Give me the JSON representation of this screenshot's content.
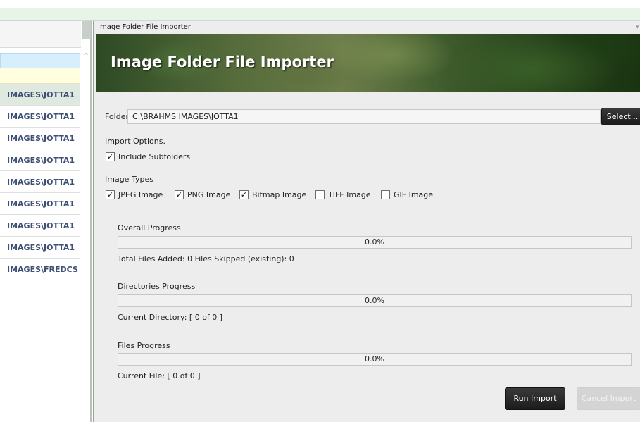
{
  "left_panel": {
    "rows": [
      "IMAGES\\JOTTA1",
      "IMAGES\\JOTTA1",
      "IMAGES\\JOTTA1",
      "IMAGES\\JOTTA1",
      "IMAGES\\JOTTA1",
      "IMAGES\\JOTTA1",
      "IMAGES\\JOTTA1",
      "IMAGES\\JOTTA1",
      "IMAGES\\FREDCS"
    ]
  },
  "importer": {
    "window_title": "Image Folder File Importer",
    "banner_title": "Image Folder File Importer",
    "folder_label": "Folder",
    "folder_value": "C:\\BRAHMS IMAGES\\JOTTA1",
    "select_label": "Select...",
    "import_options_label": "Import Options.",
    "include_subfolders": {
      "label": "Include Subfolders",
      "checked": true
    },
    "image_types_label": "Image Types",
    "image_types": [
      {
        "label": "JPEG Image",
        "checked": true
      },
      {
        "label": "PNG Image",
        "checked": true
      },
      {
        "label": "Bitmap Image",
        "checked": true
      },
      {
        "label": "TIFF Image",
        "checked": false
      },
      {
        "label": "GIF Image",
        "checked": false
      }
    ],
    "overall": {
      "label": "Overall Progress",
      "value": "0.0%",
      "progress": 0.0
    },
    "totals_text": "Total Files Added: 0    Files Skipped (existing): 0",
    "directories": {
      "label": "Directories Progress",
      "value": "0.0%",
      "progress": 0.0
    },
    "current_directory": "Current Directory: [ 0  of  0 ]",
    "files": {
      "label": "Files Progress",
      "value": "0.0%",
      "progress": 0.0
    },
    "current_file": "Current File: [ 0  of  0 ]",
    "run_label": "Run Import",
    "cancel_label": "Cancel Import"
  }
}
